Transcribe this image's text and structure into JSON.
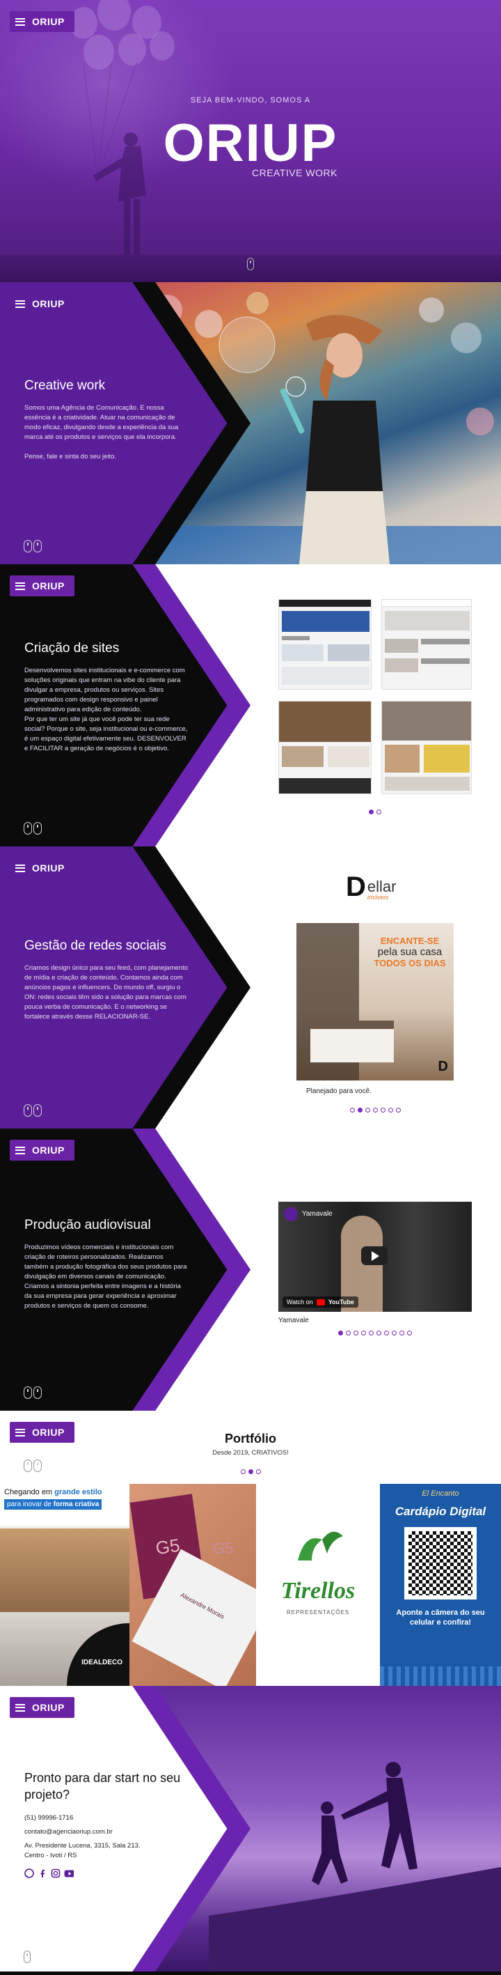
{
  "brand": {
    "name": "ORIUP",
    "menu_icon": "hamburger-icon"
  },
  "hero": {
    "welcome": "SEJA BEM-VINDO, SOMOS A",
    "title": "ORIUP",
    "subtitle": "CREATIVE WORK"
  },
  "creative": {
    "title": "Creative work",
    "body": "Somos uma Agência de Comunicação. E nossa essência é a criatividade. Atuar na comunicação de modo eficaz, divulgando desde a experiência da sua marca até os produtos e serviços que ela incorpora.\n\nPense, fale e sinta do seu jeito."
  },
  "sites": {
    "title": "Criação de sites",
    "body": "Desenvolvemos sites institucionais e e-commerce com soluções originais que entram na vibe do cliente para divulgar a empresa, produtos ou serviços. Sites programados com design responsivo e painel administrativo para edição de conteúdo.\nPor que ter um site já que você pode ter sua rede social? Porque o site, seja institucional ou e-commerce, é um espaço digital efetivamente seu. DESENVOLVER e FACILITAR a geração de negócios é o objetivo.",
    "carousel_dots": 2,
    "active_dot": 0
  },
  "social": {
    "title": "Gestão de redes sociais",
    "body": "Criamos design único para seu feed, com planejamento de mídia e criação de conteúdo. Contamos ainda com anúncios pagos e influencers. Do mundo off, surgiu o ON: redes sociais têm sido a solução para marcas com pouca verba de comunicação. E o networking se fortalece através desse RELACIONAR-SE.",
    "logo_word": "ellar",
    "logo_sub": "imóveis",
    "post_line1": "ENCANTE-SE",
    "post_line2": "pela sua casa",
    "post_line3": "TODOS OS DIAS",
    "caption": "Planejado para você.",
    "carousel_dots": 7,
    "active_dot": 1
  },
  "video": {
    "title": "Produção audiovisual",
    "body": "Produzimos vídeos comerciais e institucionais com criação de roteiros personalizados. Realizamos também a produção fotográfica dos seus produtos para divulgação em diversos canais de comunicação. Criamos a sintonia perfeita entre imagens e a história da sua empresa para gerar experiência e aproximar produtos e serviços de quem os consome.",
    "channel": "Yamavale",
    "watch_on": "Watch on",
    "youtube": "YouTube",
    "caption": "Yamavale",
    "carousel_dots": 10,
    "active_dot": 0
  },
  "portfolio": {
    "title": "Portfólio",
    "subtitle": "Desde 2019, CRIATIVOS!",
    "carousel_dots": 3,
    "active_dot": 1,
    "tile1_line1": "Chegando em",
    "tile1_bold1": "grande estilo",
    "tile1_line2": "para inovar de",
    "tile1_bold2": "forma criativa",
    "tile1_brand": "IDEALDECO",
    "tile2_name": "Alexandre Morais",
    "tile3_brand": "Tirellos",
    "tile3_sub": "REPRESENTAÇÕES",
    "tile4_title": "Cardápio Digital",
    "tile4_text": "Aponte a câmera do seu celular e confira!"
  },
  "contact": {
    "title": "Pronto para dar start no seu projeto?",
    "phone": "(51) 99996-1716",
    "email": "contato@agenciaoriup.com.br",
    "address": "Av. Presidente Lucena, 3315, Sala 213.\nCentro - Ivoti / RS"
  },
  "colors": {
    "purple": "#6b23a6",
    "purple_dark": "#5a1b94",
    "black": "#0b0b0b",
    "white": "#ffffff"
  }
}
